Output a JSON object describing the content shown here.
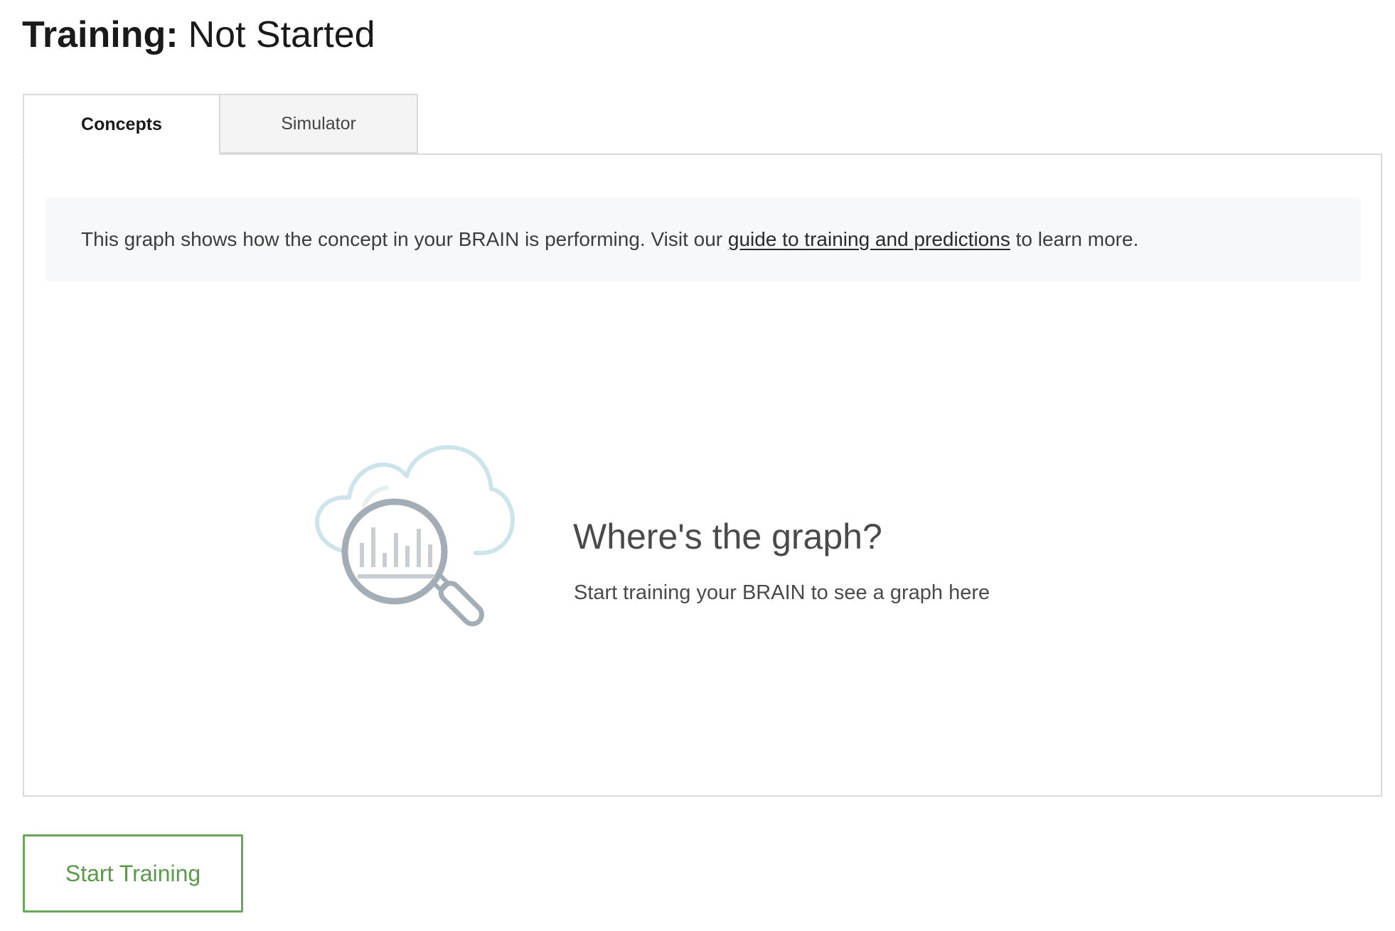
{
  "header": {
    "title_label": "Training:",
    "title_status": "Not Started"
  },
  "tabs": [
    {
      "label": "Concepts",
      "active": true
    },
    {
      "label": "Simulator",
      "active": false
    }
  ],
  "info": {
    "text_before": "This graph shows how the concept in your BRAIN is performing. Visit our ",
    "link_text": "guide to training and predictions",
    "text_after": " to learn more."
  },
  "empty_state": {
    "icon": "cloud-magnifier-chart-icon",
    "title": "Where's the graph?",
    "subtitle": "Start training your BRAIN to see a graph here"
  },
  "actions": {
    "start_training_label": "Start Training"
  },
  "colors": {
    "accent_green": "#69a85c",
    "cloud": "#cde4ea",
    "magnifier": "#a3adb5"
  }
}
